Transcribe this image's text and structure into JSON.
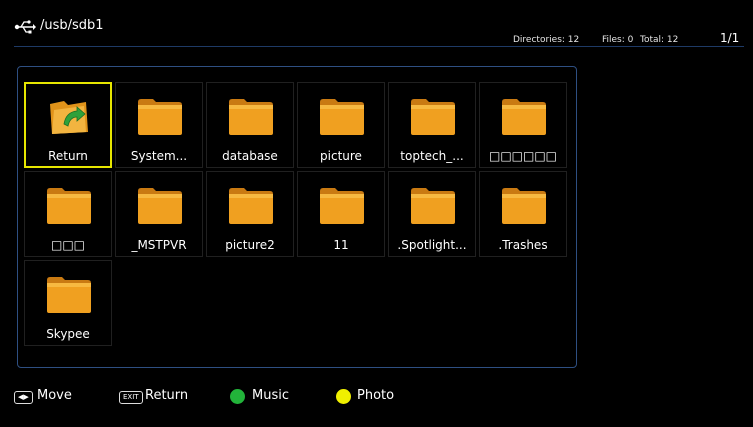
{
  "header": {
    "path": "/usb/sdb1",
    "stats": {
      "directories": "Directories: 12",
      "files": "Files: 0",
      "total": "Total: 12"
    },
    "page": "1/1"
  },
  "tiles": [
    {
      "label": "Return",
      "icon": "return-folder-icon",
      "selected": true
    },
    {
      "label": "System...",
      "icon": "folder-icon"
    },
    {
      "label": "database",
      "icon": "folder-icon"
    },
    {
      "label": "picture",
      "icon": "folder-icon"
    },
    {
      "label": "toptech_...",
      "icon": "folder-icon"
    },
    {
      "label": "□□□□□□",
      "icon": "folder-icon"
    },
    {
      "label": "□□□",
      "icon": "folder-icon"
    },
    {
      "label": "_MSTPVR",
      "icon": "folder-icon"
    },
    {
      "label": "picture2",
      "icon": "folder-icon"
    },
    {
      "label": "11",
      "icon": "folder-icon"
    },
    {
      "label": ".Spotlight...",
      "icon": "folder-icon"
    },
    {
      "label": ".Trashes",
      "icon": "folder-icon"
    },
    {
      "label": "Skypee",
      "icon": "folder-icon"
    }
  ],
  "footer": {
    "move_key": "◀▶",
    "move_label": "Move",
    "exit_key": "EXIT",
    "return_label": "Return",
    "music_label": "Music",
    "photo_label": "Photo"
  },
  "colors": {
    "selection": "#e6e600",
    "music_dot": "#22b33a",
    "photo_dot": "#f0f000",
    "folder": "#f0a020",
    "panel_border": "#2e4f82"
  }
}
